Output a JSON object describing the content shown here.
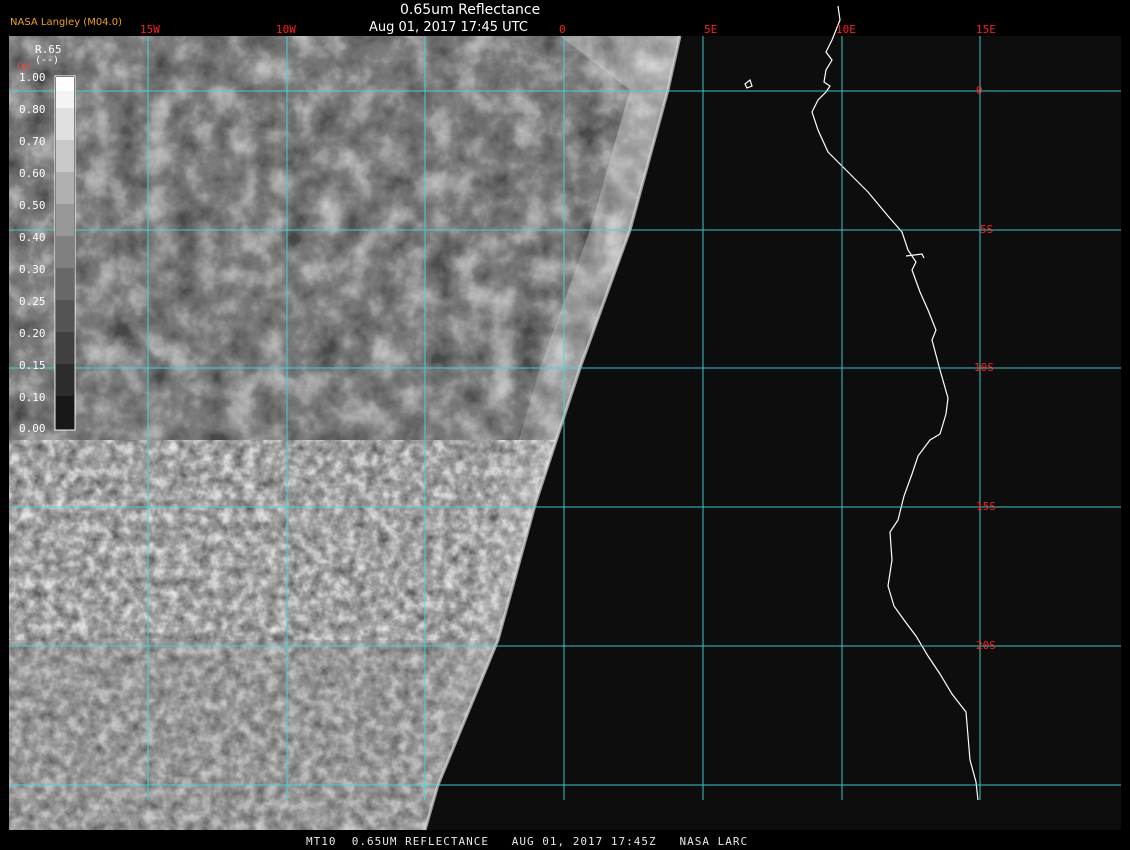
{
  "header": {
    "title": "0.65um Reflectance",
    "subtitle": "Aug 01, 2017 17:45 UTC",
    "source": "NASA Langley (M04.0)"
  },
  "footer": {
    "text": "MT10  0.65UM REFLECTANCE   AUG 01, 2017 17:45Z   NASA LARC"
  },
  "legend": {
    "variable": "R.65",
    "unit": "(--)",
    "corner_label": "(K)",
    "ticks": [
      "1.00",
      "0.80",
      "0.70",
      "0.60",
      "0.50",
      "0.40",
      "0.30",
      "0.25",
      "0.20",
      "0.15",
      "0.10",
      "0.00"
    ]
  },
  "map": {
    "lon_labels": [
      "15W",
      "10W",
      "0",
      "5E",
      "10E",
      "15E"
    ],
    "lat_labels": [
      "0",
      "5S",
      "10S",
      "15S",
      "20S"
    ],
    "colors": {
      "grid": "#40d8e0",
      "grid_label": "#ff2020",
      "coastline": "#ffffff",
      "background": "#0d0d0d"
    }
  }
}
